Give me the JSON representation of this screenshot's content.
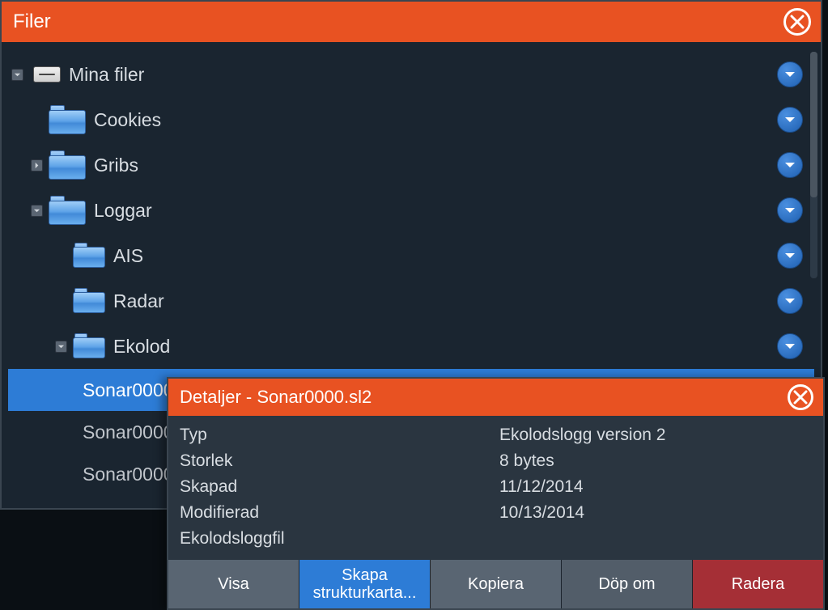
{
  "window": {
    "title": "Filer"
  },
  "tree": {
    "root": {
      "label": "Mina filer"
    },
    "children": [
      {
        "label": "Cookies"
      },
      {
        "label": "Gribs"
      },
      {
        "label": "Loggar"
      }
    ],
    "loggar_children": [
      {
        "label": "AIS"
      },
      {
        "label": "Radar"
      },
      {
        "label": "Ekolod"
      }
    ],
    "ekolod_files": [
      {
        "label": "Sonar0000"
      },
      {
        "label": "Sonar0000"
      },
      {
        "label": "Sonar0000"
      }
    ]
  },
  "details": {
    "title": "Detaljer - Sonar0000.sl2",
    "fields": {
      "type_label": "Typ",
      "type_value": "Ekolodslogg version 2",
      "size_label": "Storlek",
      "size_value": "8 bytes",
      "created_label": "Skapad",
      "created_value": "11/12/2014",
      "modified_label": "Modifierad",
      "modified_value": "10/13/2014",
      "extra_label": "Ekolodsloggfil"
    },
    "buttons": {
      "view": "Visa",
      "create_map": "Skapa strukturkarta...",
      "copy": "Kopiera",
      "rename": "Döp om",
      "delete": "Radera"
    }
  }
}
